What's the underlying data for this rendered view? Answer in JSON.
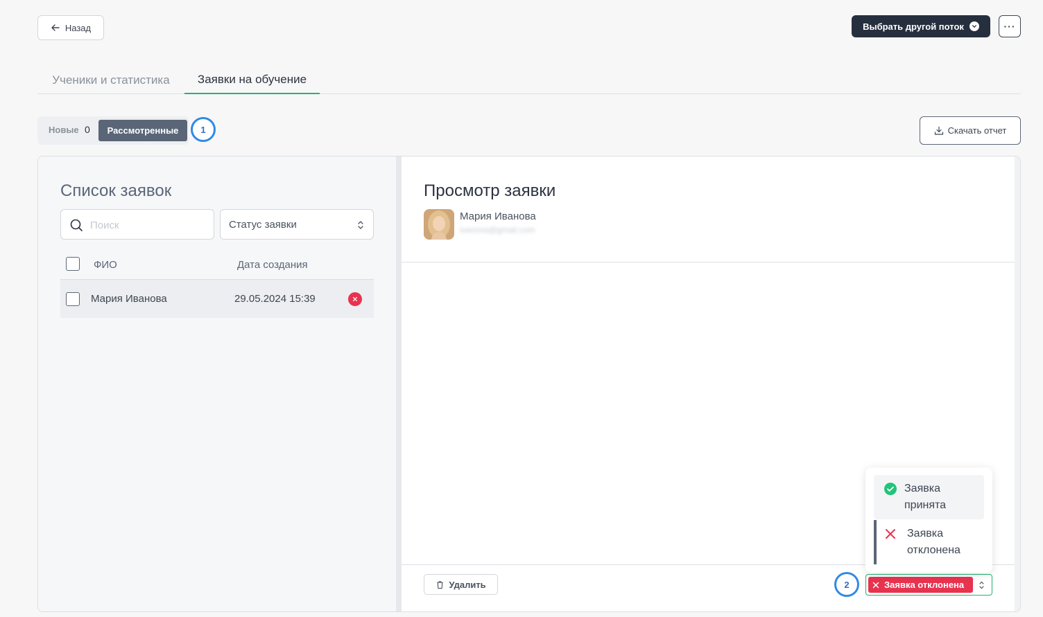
{
  "header": {
    "back_label": "Назад",
    "stream_label": "Выбрать другой поток",
    "more_label": "···"
  },
  "tabs": [
    {
      "label": "Ученики и статистика"
    },
    {
      "label": "Заявки на обучение"
    }
  ],
  "filter": {
    "new_label": "Новые",
    "new_count": "0",
    "reviewed_label": "Рассмотренные"
  },
  "annotations": {
    "one": "1",
    "two": "2"
  },
  "report_label": "Скачать отчет",
  "list": {
    "title": "Список заявок",
    "search_placeholder": "Поиск",
    "status_select": "Статус заявки",
    "col_name": "ФИО",
    "col_date": "Дата создания",
    "rows": [
      {
        "name": "Мария Иванова",
        "date": "29.05.2024 15:39"
      }
    ]
  },
  "view": {
    "title": "Просмотр заявки",
    "user_name": "Мария Иванова",
    "user_email": "ivanova@gmail.com",
    "delete_label": "Удалить",
    "status_label": "Заявка отклонена"
  },
  "dropdown": {
    "accept_label": "Заявка принята",
    "reject_label": "Заявка отклонена"
  },
  "colors": {
    "accent_green": "#22b573",
    "reject_red": "#e8334f",
    "dark_button": "#262f3e",
    "annotation_blue": "#2f8ae5"
  }
}
